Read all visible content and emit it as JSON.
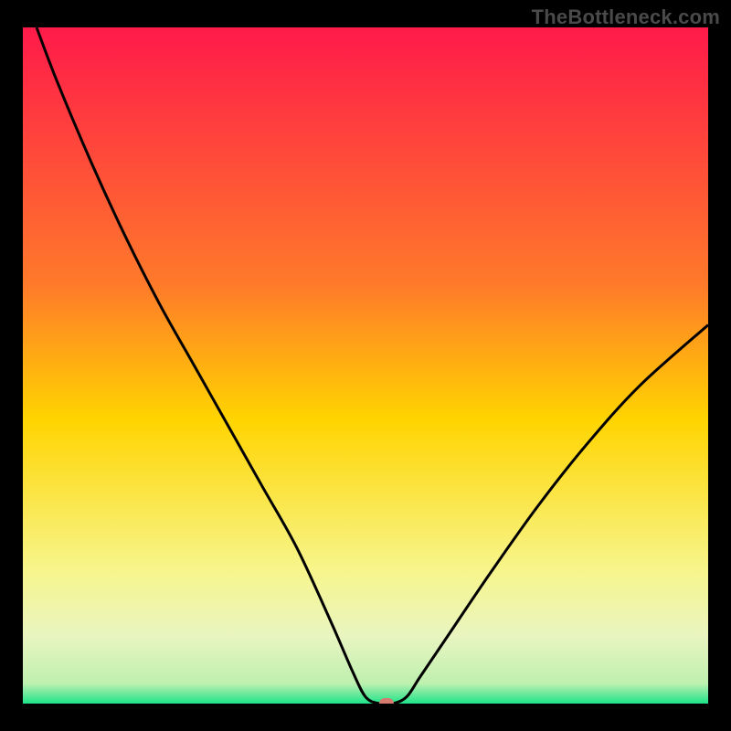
{
  "watermark": "TheBottleneck.com",
  "colors": {
    "top": "#ff1a4a",
    "mid1": "#ff6a2a",
    "mid2": "#ffd400",
    "yellowish": "#f7f58a",
    "pale": "#f0f7cf",
    "green": "#1ee38a",
    "marker": "#d77a6f",
    "curve": "#000000"
  },
  "chart_data": {
    "type": "line",
    "title": "",
    "xlabel": "",
    "ylabel": "",
    "xlim": [
      0,
      100
    ],
    "ylim": [
      0,
      100
    ],
    "series": [
      {
        "name": "bottleneck-curve",
        "x": [
          2,
          5,
          10,
          15,
          20,
          25,
          30,
          35,
          40,
          45,
          48,
          50,
          52,
          54,
          56,
          58,
          62,
          68,
          75,
          82,
          90,
          100
        ],
        "y": [
          100,
          92,
          80,
          69,
          59,
          50,
          41,
          32,
          23,
          12,
          5,
          1,
          0,
          0,
          1,
          4,
          10,
          19,
          29,
          38,
          47,
          56
        ]
      }
    ],
    "marker": {
      "x": 53,
      "y": 0
    },
    "gradient_stops": [
      {
        "pos": 0,
        "color": "#ff1a4a"
      },
      {
        "pos": 38,
        "color": "#ff7a2a"
      },
      {
        "pos": 58,
        "color": "#ffd400"
      },
      {
        "pos": 80,
        "color": "#f7f58a"
      },
      {
        "pos": 90,
        "color": "#e9f5c0"
      },
      {
        "pos": 97,
        "color": "#bff0b0"
      },
      {
        "pos": 100,
        "color": "#1ee38a"
      }
    ]
  }
}
